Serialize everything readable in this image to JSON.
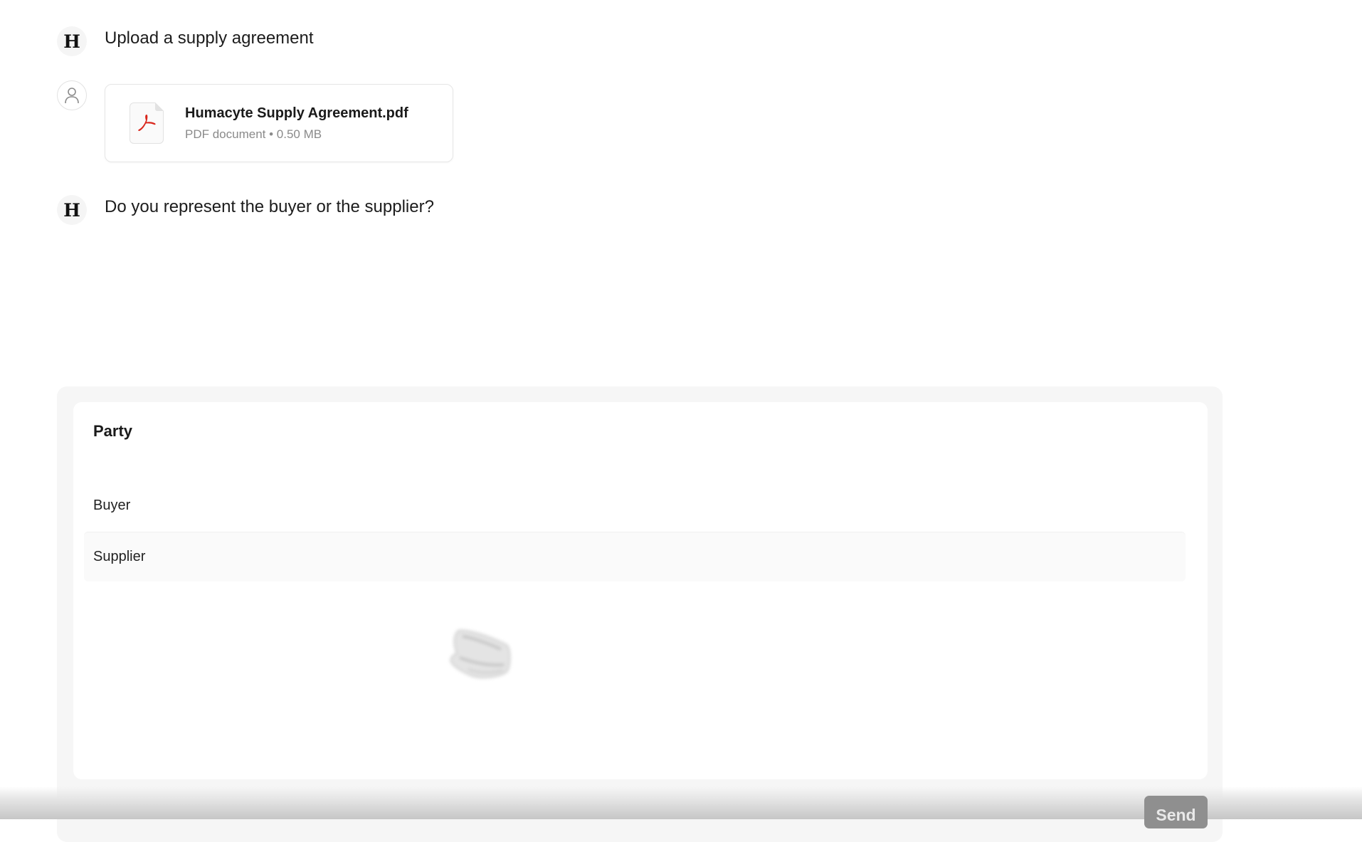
{
  "chat": {
    "messages": [
      {
        "sender": "assistant",
        "avatar_letter": "H",
        "text": "Upload a supply agreement"
      },
      {
        "sender": "user",
        "attachment": {
          "file_name": "Humacyte Supply Agreement.pdf",
          "file_meta": "PDF document • 0.50 MB",
          "icon": "pdf-icon"
        }
      },
      {
        "sender": "assistant",
        "avatar_letter": "H",
        "text": "Do you represent the buyer or the supplier?"
      }
    ]
  },
  "party_panel": {
    "title": "Party",
    "options": [
      "Buyer",
      "Supplier"
    ],
    "highlighted_option": "Supplier"
  },
  "composer": {
    "send_label": "Send"
  },
  "colors": {
    "pdf_red": "#d9261c",
    "send_disabled": "#8f8f8f"
  }
}
